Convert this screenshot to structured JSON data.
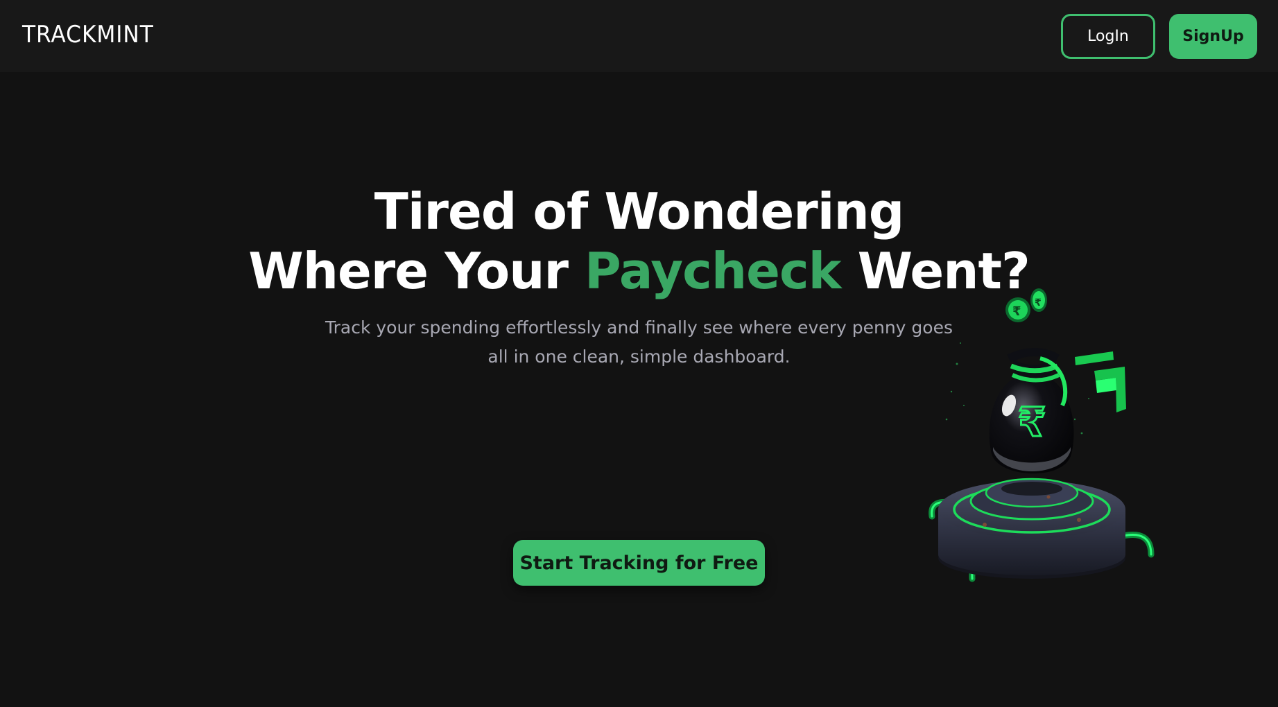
{
  "header": {
    "logo_text": "TRACKMINT",
    "login_label": "LogIn",
    "signup_label": "SignUp"
  },
  "hero": {
    "title_line1": "Tired of Wondering",
    "title_line2_prefix": "Where Your ",
    "title_line2_accent": "Paycheck",
    "title_line2_suffix": " Went?",
    "subtitle_line1": "Track your spending effortlessly and finally see where every penny goes",
    "subtitle_line2": "all in one clean, simple dashboard.",
    "cta_label": "Start Tracking for Free"
  },
  "illustration": {
    "icon": "money-bag-rupee-icon",
    "coin_symbol": "₹"
  },
  "colors": {
    "background": "#121212",
    "navbar": "#181818",
    "accent": "#3fbf6f",
    "accent_text": "#3aa764",
    "subtitle": "#a8a8b3"
  }
}
